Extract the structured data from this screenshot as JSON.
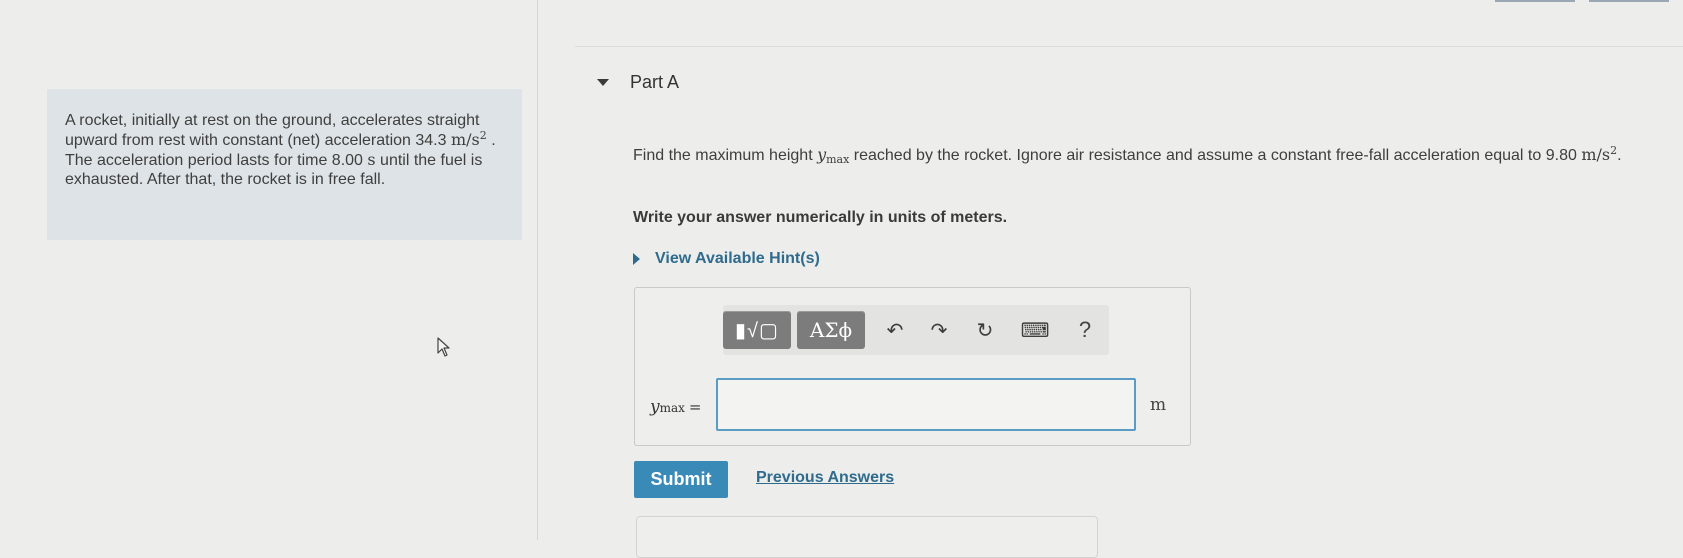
{
  "problem": {
    "text_1": "A rocket, initially at rest on the ground, accelerates straight upward from rest with constant (net) acceleration 34.3 ",
    "accel_unit_base": "m/s",
    "accel_unit_exp": "2",
    "text_2": " . The acceleration period lasts for time 8.00 ",
    "time_unit": "s",
    "text_3": " until the fuel is exhausted. After that, the rocket is in free fall."
  },
  "part": {
    "title": "Part A"
  },
  "question": {
    "text_1": "Find the maximum height ",
    "var_main": "y",
    "var_sub": "max",
    "text_2": " reached by the rocket. Ignore air resistance and assume a constant free-fall acceleration equal to ",
    "g_value": "9.80 ",
    "g_unit_base": "m/s",
    "g_unit_exp": "2",
    "end": "."
  },
  "instruction": "Write your answer numerically in units of meters.",
  "hint": {
    "label": "View Available Hint(s)"
  },
  "toolbar": {
    "templates_glyph": "▮√▢",
    "symbols_label": "ΑΣϕ",
    "undo_glyph": "↶",
    "redo_glyph": "↷",
    "reset_glyph": "↻",
    "keyboard_glyph": "⌨",
    "help_label": "?"
  },
  "answer": {
    "var_main": "y",
    "var_sub": "max",
    "equals": "=",
    "value": "",
    "unit": "m"
  },
  "actions": {
    "submit_label": "Submit",
    "previous_answers_label": "Previous Answers"
  },
  "colors": {
    "accent": "#3a8ab8",
    "link": "#2e6b8d",
    "problem_bg": "#dde3e6"
  }
}
